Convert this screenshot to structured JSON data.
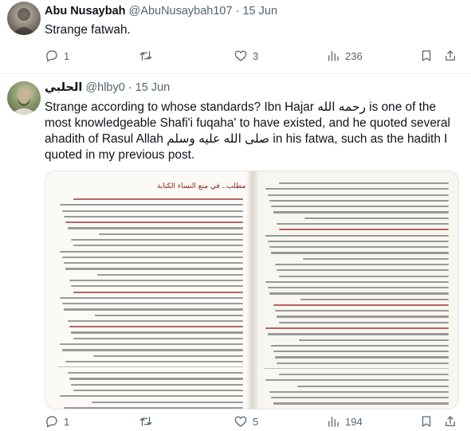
{
  "tweets": [
    {
      "display_name": "Abu Nusaybah",
      "handle": "@AbuNusaybah107",
      "separator": "·",
      "date": "15 Jun",
      "text": "Strange fatwah.",
      "stats": {
        "replies": "1",
        "retweets": "",
        "likes": "3",
        "views": "236"
      }
    },
    {
      "display_name": "الحلبي",
      "handle": "@hlby0",
      "separator": "·",
      "date": "15 Jun",
      "text": "Strange according to whose standards? Ibn Hajar رحمه الله is one of the most knowledgeable Shafi'i fuqaha' to have existed, and he quoted several ahadith of Rasul Allah صلى الله عليه وسلم in his fatwa, such as the hadith I quoted in my previous post.",
      "book_heading": "مطلب.. في منع النساء الكتابة",
      "stats": {
        "replies": "1",
        "retweets": "",
        "likes": "5",
        "views": "194"
      }
    }
  ],
  "icons": [
    "reply-icon",
    "retweet-icon",
    "like-icon",
    "views-icon",
    "bookmark-icon",
    "share-icon"
  ],
  "colors": {
    "secondary_text": "#536471",
    "primary_text": "#0f1419",
    "divider": "#eff3f4",
    "book_heading": "#8a1b1b"
  }
}
